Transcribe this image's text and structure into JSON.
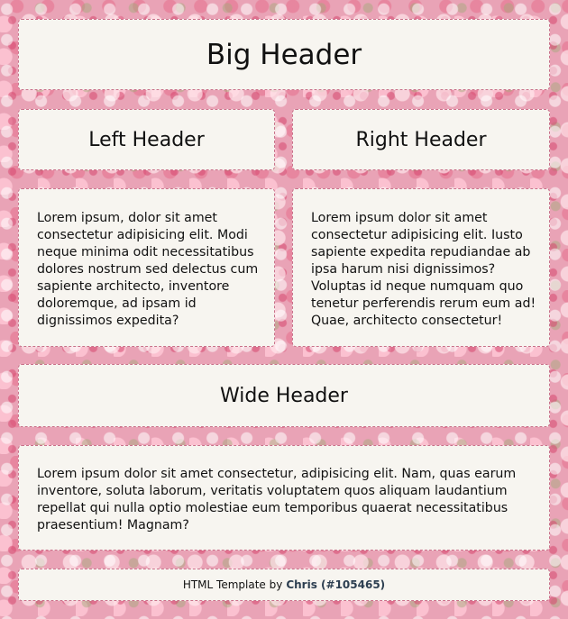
{
  "big_header": "Big Header",
  "left_header": "Left Header",
  "right_header": "Right Header",
  "left_text": "Lorem ipsum, dolor sit amet consectetur adipisicing elit. Modi neque minima odit necessitatibus dolores nostrum sed delectus cum sapiente architecto, inventore doloremque, ad ipsam id dignissimos expedita?",
  "right_text": "Lorem ipsum dolor sit amet consectetur adipisicing elit. Iusto sapiente expedita repudiandae ab ipsa harum nisi dignissimos? Voluptas id neque numquam quo tenetur perferendis rerum eum ad! Quae, architecto consectetur!",
  "wide_header": "Wide Header",
  "wide_text": "Lorem ipsum dolor sit amet consectetur, adipisicing elit. Nam, quas earum inventore, soluta laborum, veritatis voluptatem quos aliquam laudantium repellat qui nulla optio molestiae eum temporibus quaerat necessitatibus praesentium! Magnam?",
  "footer": {
    "prefix": "HTML Template by",
    "author": "Chris (#105465)"
  },
  "colors": {
    "panel_bg": "#f7f5f0",
    "border": "#c9708a",
    "background": "#e9a3b6",
    "author_text": "#2c3e50"
  }
}
